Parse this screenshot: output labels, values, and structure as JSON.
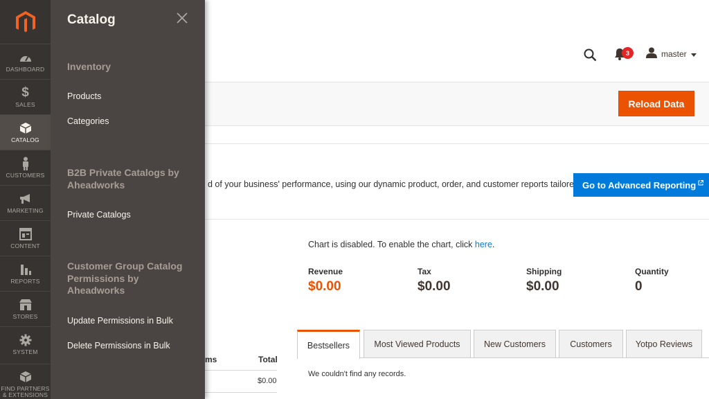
{
  "nav": {
    "items": [
      {
        "label": "DASHBOARD",
        "icon": "dashboard-icon"
      },
      {
        "label": "SALES",
        "icon": "dollar-icon"
      },
      {
        "label": "CATALOG",
        "icon": "box-icon"
      },
      {
        "label": "CUSTOMERS",
        "icon": "person-icon"
      },
      {
        "label": "MARKETING",
        "icon": "megaphone-icon"
      },
      {
        "label": "CONTENT",
        "icon": "layout-icon"
      },
      {
        "label": "REPORTS",
        "icon": "bar-chart-icon"
      },
      {
        "label": "STORES",
        "icon": "store-icon"
      },
      {
        "label": "SYSTEM",
        "icon": "gear-icon"
      },
      {
        "label_line1": "FIND PARTNERS",
        "label_line2": "& EXTENSIONS",
        "icon": "cubes-icon"
      }
    ]
  },
  "flyout": {
    "title": "Catalog",
    "sections": [
      {
        "title": "Inventory",
        "links": [
          "Products",
          "Categories"
        ]
      },
      {
        "title": "B2B Private Catalogs by Aheadworks",
        "links": [
          "Private Catalogs"
        ]
      },
      {
        "title": "Customer Group Catalog Permissions by Aheadworks",
        "links": [
          "Update Permissions in Bulk",
          "Delete Permissions in Bulk"
        ]
      }
    ]
  },
  "header": {
    "notification_count": "3",
    "username": "master"
  },
  "actions": {
    "reload": "Reload Data"
  },
  "reporting": {
    "text": "d of your business' performance, using our dynamic product, order, and customer reports tailored",
    "button": "Go to Advanced Reporting"
  },
  "chart": {
    "message": "Chart is disabled. To enable the chart, click ",
    "link": "here",
    "period": "."
  },
  "stats": [
    {
      "label": "Revenue",
      "value": "$0.00"
    },
    {
      "label": "Tax",
      "value": "$0.00"
    },
    {
      "label": "Shipping",
      "value": "$0.00"
    },
    {
      "label": "Quantity",
      "value": "0"
    }
  ],
  "left_table": {
    "col_items_partial": "ms",
    "col_total": "Total",
    "value": "$0.00"
  },
  "tabs": [
    "Bestsellers",
    "Most Viewed Products",
    "New Customers",
    "Customers",
    "Yotpo Reviews"
  ],
  "empty_message": "We couldn't find any records.",
  "colors": {
    "accent": "#eb5202",
    "link": "#007bdb",
    "nav_bg": "#373330",
    "flyout_bg": "#4a4542"
  }
}
